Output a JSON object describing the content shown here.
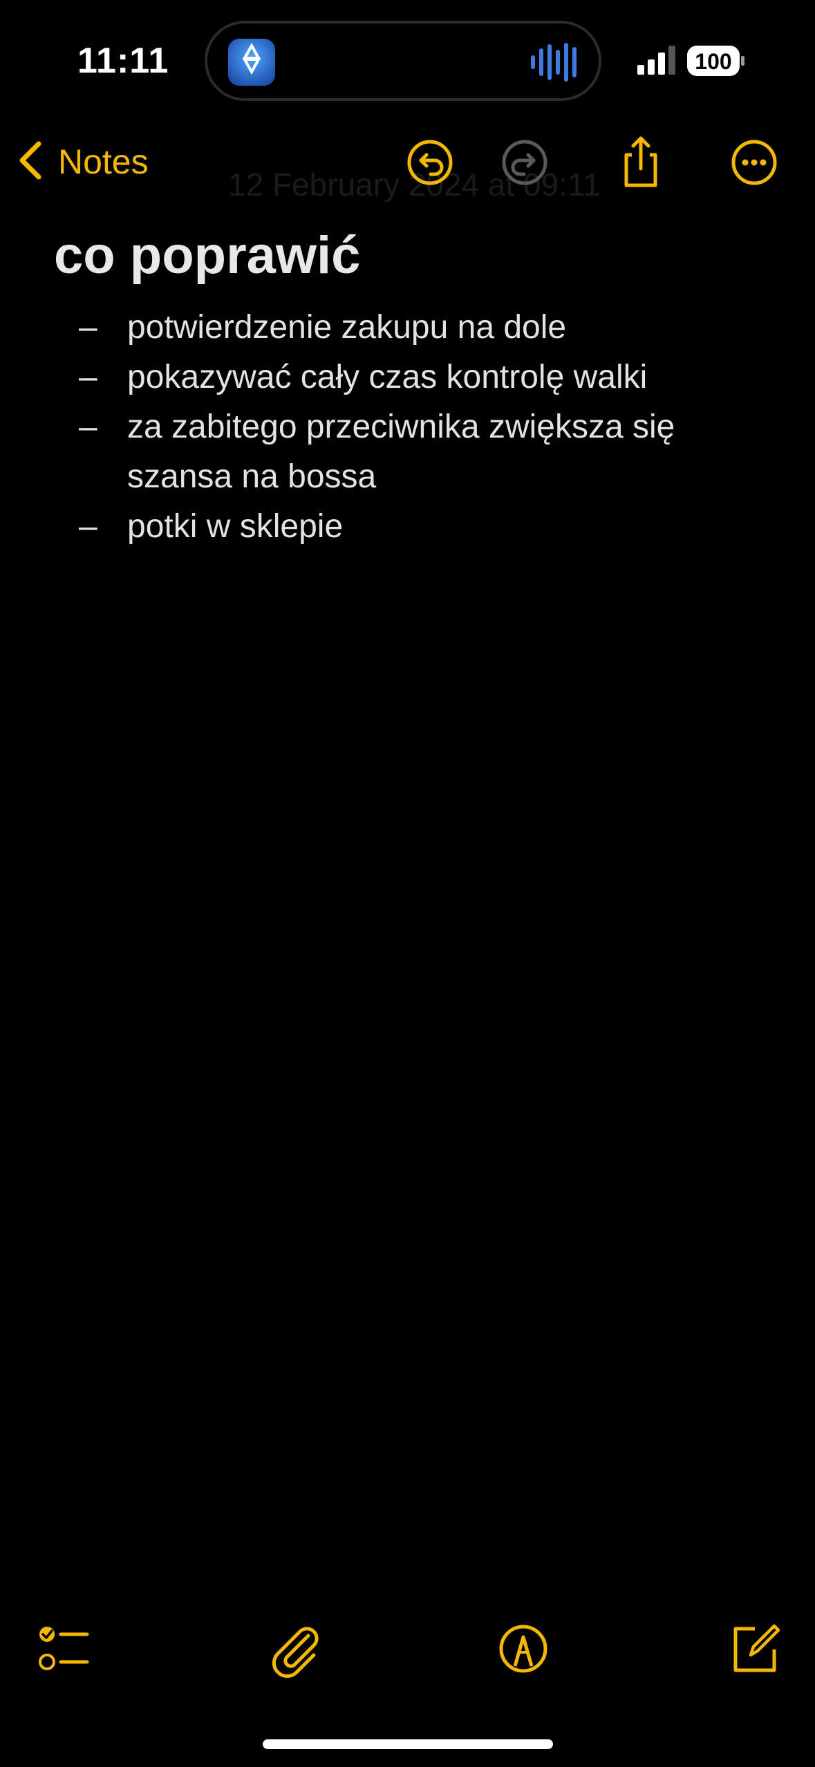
{
  "status_bar": {
    "time": "11:11",
    "battery": "100",
    "island_app_icon": "star-badge-app-icon",
    "icons": [
      "audio-waveform-icon",
      "cellular-signal-icon",
      "battery-icon"
    ]
  },
  "nav": {
    "back_label": "Notes",
    "date_ghost": "12 February 2024 at 09:11",
    "icons": [
      "chevron-left-icon",
      "undo-icon",
      "redo-icon",
      "share-icon",
      "more-icon"
    ]
  },
  "note": {
    "title": "co poprawić",
    "dash": "–",
    "items": [
      "potwierdzenie zakupu na dole",
      "pokazywać cały czas kontrolę walki",
      "za zabitego przeciwnika zwiększa się szansa na bossa",
      "potki w sklepie"
    ]
  },
  "toolbar": {
    "icons": [
      "checklist-icon",
      "paperclip-icon",
      "markup-pen-icon",
      "compose-icon"
    ]
  },
  "colors": {
    "accent": "#f5b800",
    "background": "#000000",
    "text": "#e6e6e6",
    "disabled": "#5a5a5a"
  }
}
